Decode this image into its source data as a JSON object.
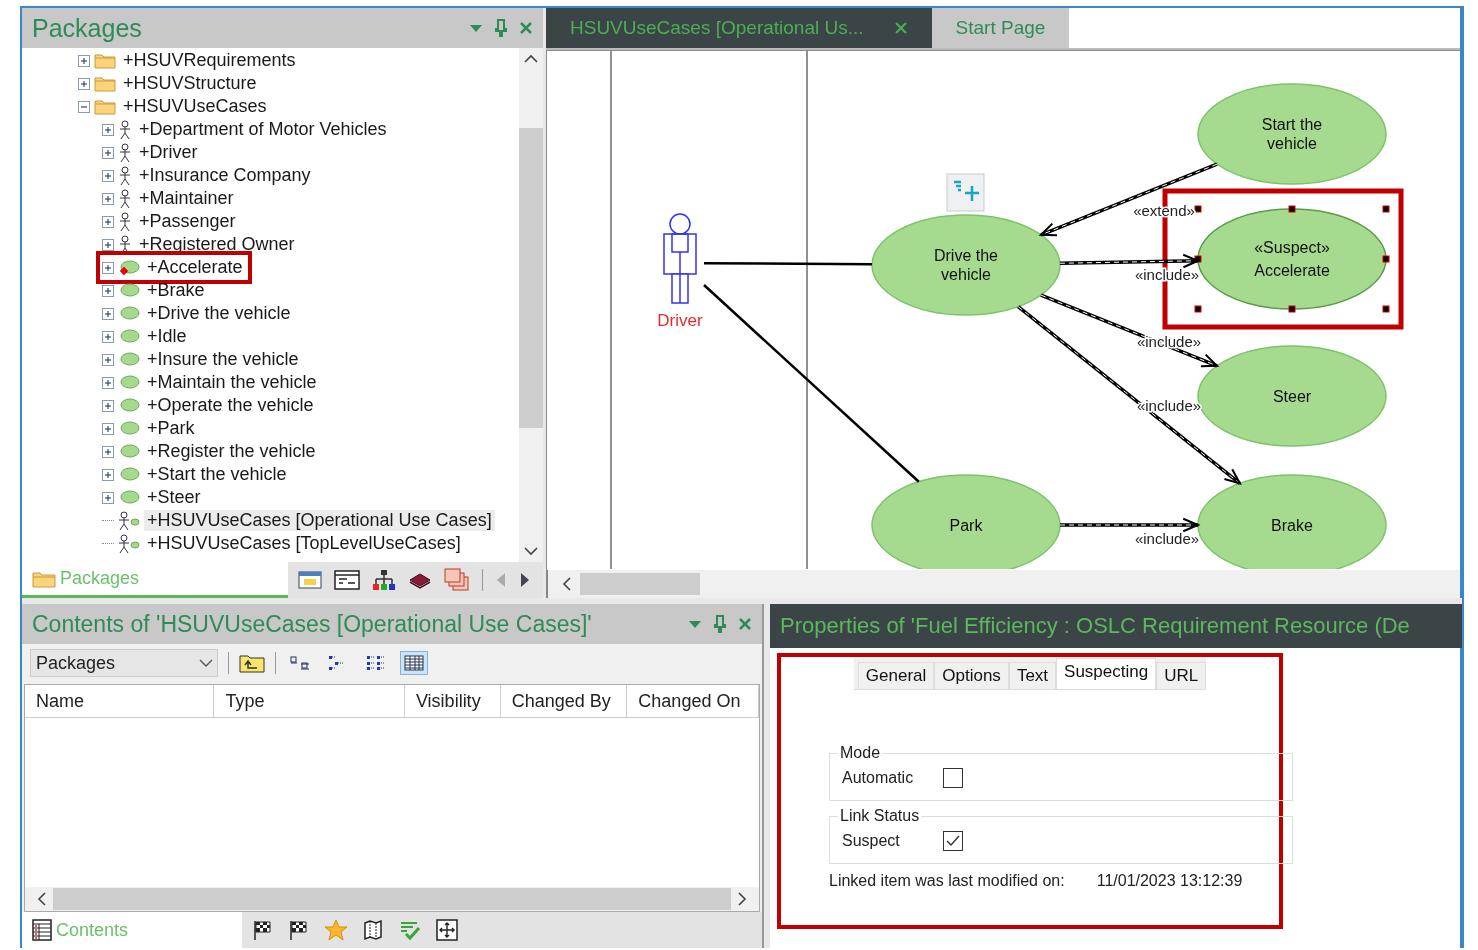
{
  "packages": {
    "title": "Packages",
    "tree": [
      {
        "label": "+HSUVRequirements",
        "kind": "folder",
        "expanded": false,
        "selected": false
      },
      {
        "label": "+HSUVStructure",
        "kind": "folder",
        "expanded": false,
        "selected": false
      },
      {
        "label": "+HSUVUseCases",
        "kind": "folder",
        "expanded": true,
        "selected": false,
        "children": [
          {
            "label": "+Department of Motor Vehicles",
            "kind": "actor",
            "expanded": false,
            "selected": false
          },
          {
            "label": "+Driver",
            "kind": "actor",
            "expanded": false,
            "selected": false
          },
          {
            "label": "+Insurance Company",
            "kind": "actor",
            "expanded": false,
            "selected": false
          },
          {
            "label": "+Maintainer",
            "kind": "actor",
            "expanded": false,
            "selected": false
          },
          {
            "label": "+Passenger",
            "kind": "actor",
            "expanded": false,
            "selected": false
          },
          {
            "label": "+Registered Owner",
            "kind": "actor",
            "expanded": false,
            "selected": false
          },
          {
            "label": "+Accelerate",
            "kind": "usecase",
            "expanded": false,
            "selected": false,
            "suspect": true,
            "highlighted": true
          },
          {
            "label": "+Brake",
            "kind": "usecase",
            "expanded": false,
            "selected": false
          },
          {
            "label": "+Drive the vehicle",
            "kind": "usecase",
            "expanded": false,
            "selected": false
          },
          {
            "label": "+Idle",
            "kind": "usecase",
            "expanded": false,
            "selected": false
          },
          {
            "label": "+Insure the vehicle",
            "kind": "usecase",
            "expanded": false,
            "selected": false
          },
          {
            "label": "+Maintain the vehicle",
            "kind": "usecase",
            "expanded": false,
            "selected": false
          },
          {
            "label": "+Operate the vehicle",
            "kind": "usecase",
            "expanded": false,
            "selected": false
          },
          {
            "label": "+Park",
            "kind": "usecase",
            "expanded": false,
            "selected": false
          },
          {
            "label": "+Register the vehicle",
            "kind": "usecase",
            "expanded": false,
            "selected": false
          },
          {
            "label": "+Start the vehicle",
            "kind": "usecase",
            "expanded": false,
            "selected": false
          },
          {
            "label": "+Steer",
            "kind": "usecase",
            "expanded": false,
            "selected": false
          },
          {
            "label": "+HSUVUseCases [Operational Use Cases]",
            "kind": "diagram",
            "selected": true
          },
          {
            "label": "+HSUVUseCases [TopLevelUseCases]",
            "kind": "diagram",
            "selected": false
          }
        ]
      }
    ],
    "bottom_tab": "Packages"
  },
  "diagram": {
    "tabs": [
      {
        "label": "HSUVUseCases [Operational Us...",
        "selected": true
      },
      {
        "label": "Start Page",
        "selected": false
      }
    ],
    "nodes": [
      {
        "kind": "actor",
        "name": "Driver",
        "selected": false
      },
      {
        "kind": "usecase",
        "name": "Drive the vehicle",
        "selected": false
      },
      {
        "kind": "usecase",
        "name": "Start the vehicle",
        "selected": false
      },
      {
        "kind": "usecase",
        "stereotype": "«Suspect»",
        "name": "Accelerate",
        "selected": true
      },
      {
        "kind": "usecase",
        "name": "Steer",
        "selected": false
      },
      {
        "kind": "usecase",
        "name": "Park",
        "selected": false
      },
      {
        "kind": "usecase",
        "name": "Brake",
        "selected": false
      }
    ],
    "connectors": [
      {
        "kind": "association"
      },
      {
        "kind": "association"
      },
      {
        "kind": "extend",
        "label": "«extend»"
      },
      {
        "kind": "include",
        "label": "«include»"
      },
      {
        "kind": "include",
        "label": "«include»"
      },
      {
        "kind": "include",
        "label": "«include»"
      },
      {
        "kind": "include",
        "label": "«include»"
      }
    ]
  },
  "contents": {
    "title": "Contents of 'HSUVUseCases [Operational Use Cases]'",
    "filter": {
      "value": "Packages"
    },
    "view_modes": [
      {
        "kind": "small",
        "selected": false
      },
      {
        "kind": "tree",
        "selected": false
      },
      {
        "kind": "list",
        "selected": false
      },
      {
        "kind": "details",
        "selected": true
      }
    ],
    "columns": [
      "Name",
      "Type",
      "Visibility",
      "Changed By",
      "Changed On"
    ],
    "bottom_tab": "Contents"
  },
  "properties": {
    "title": "Properties of 'Fuel Efficiency : OSLC Requirement Resource (De",
    "tabs": [
      {
        "label": "General",
        "selected": false
      },
      {
        "label": "Options",
        "selected": false
      },
      {
        "label": "Text",
        "selected": false
      },
      {
        "label": "Suspecting",
        "selected": true
      },
      {
        "label": "URL",
        "selected": false
      }
    ],
    "highlighted": true,
    "groups": [
      {
        "title": "Mode",
        "options": [
          {
            "label": "Automatic",
            "checked": false
          }
        ]
      },
      {
        "title": "Link Status",
        "options": [
          {
            "label": "Suspect",
            "checked": true
          }
        ]
      }
    ],
    "modified_label": "Linked item was last modified on:",
    "modified_value": "11/01/2023 13:12:39"
  }
}
